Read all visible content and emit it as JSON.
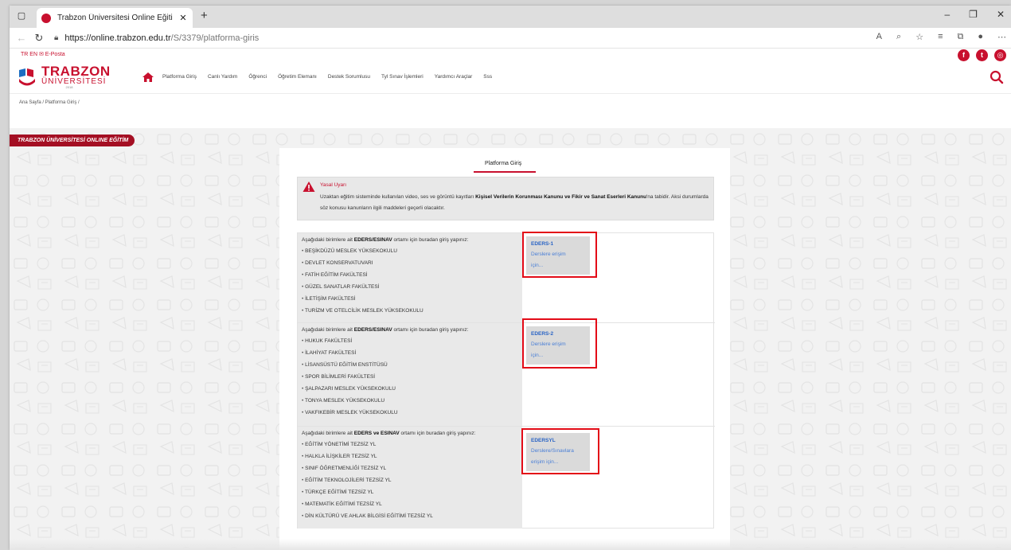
{
  "browser": {
    "tab_title": "Trabzon Üniversitesi Online Eğiti",
    "url_host": "https://online.trabzon.edu.tr",
    "url_path": "/S/3379/platforma-giris"
  },
  "site": {
    "lang_links": "TR  EN  ✉ E-Posta",
    "logo_title": "TRABZON",
    "logo_subtitle": "ÜNİVERSİTESİ",
    "logo_year": "2018",
    "menu": [
      "Platforma Giriş",
      "Canlı Yardım",
      "Öğrenci",
      "Öğretim Elemanı",
      "Destek Sorumlusu",
      "Tyl Sınav İşlemleri",
      "Yardımcı Araçlar",
      "Sss"
    ],
    "breadcrumb": "Ana Sayfa /  Platforma Giriş /",
    "ribbon": "TRABZON ÜNİVERSİTESİ ONLINE EĞİTİM"
  },
  "panel": {
    "title": "Platforma Giriş",
    "warning": {
      "title": "Yasal Uyarı",
      "text_before": "Uzaktan eğitim sisteminde kullanılan video, ses ve görüntü kayıtları ",
      "text_bold": "Kişisel Verilerin Korunması Kanunu ve Fikir ve Sanat Eserleri Kanunu",
      "text_after": "'na tabidir. Aksi durumlarda söz konusu kanunların ilgili maddeleri geçerli olacaktır."
    },
    "units": [
      {
        "intro_before": "Aşağıdaki birimlere ait ",
        "intro_bold": "EDERS/ESINAV",
        "intro_after": " ortamı için buradan giriş yapınız:",
        "items": [
          "BEŞİKDÜZÜ MESLEK YÜKSEKOKULU",
          "DEVLET KONSERVATUVARI",
          "FATİH EĞİTİM FAKÜLTESİ",
          "GÜZEL SANATLAR FAKÜLTESİ",
          "İLETİŞİM FAKÜLTESİ",
          "TURİZM VE OTELCİLİK MESLEK YÜKSEKOKULU"
        ],
        "link_name": "EDERS-1",
        "link_line1": "Derslere erişim",
        "link_line2": "için..."
      },
      {
        "intro_before": "Aşağıdaki birimlere ait ",
        "intro_bold": "EDERS/ESINAV",
        "intro_after": " ortamı için buradan giriş yapınız:",
        "items": [
          "HUKUK FAKÜLTESİ",
          "İLAHİYAT FAKÜLTESİ",
          "LİSANSÜSTÜ EĞİTİM ENSTİTÜSÜ",
          "SPOR BİLİMLERİ FAKÜLTESİ",
          "ŞALPAZARI MESLEK YÜKSEKOKULU",
          "TONYA MESLEK YÜKSEKOKULU",
          "VAKFIKEBİR MESLEK YÜKSEKOKULU"
        ],
        "link_name": "EDERS-2",
        "link_line1": "Derslere erişim",
        "link_line2": "için..."
      },
      {
        "intro_before": "Aşağıdaki birimlere ait ",
        "intro_bold": "EDERS ve ESINAV",
        "intro_after": " ortamı için buradan giriş yapınız:",
        "items": [
          "EĞİTİM YÖNETİMİ TEZSİZ YL",
          "HALKLA İLİŞKİLER TEZSİZ YL",
          "SINIF ÖĞRETMENLİĞİ TEZSİZ YL",
          "EĞİTİM TEKNOLOJİLERİ TEZSİZ YL",
          "TÜRKÇE EĞİTİMİ TEZSİZ YL",
          "MATEMATİK EĞİTİMİ TEZSİZ YL",
          "DİN KÜLTÜRÜ VE AHLAK BİLGİSİ EĞİTİMİ TEZSİZ YL"
        ],
        "link_name": "EDERSYL",
        "link_line1": "Derslere/Sınavlara",
        "link_line2": "erişim için..."
      }
    ]
  },
  "colors": {
    "brand_red": "#c8102e",
    "link_blue": "#2a64c5",
    "highlight_red": "#e30b17"
  }
}
